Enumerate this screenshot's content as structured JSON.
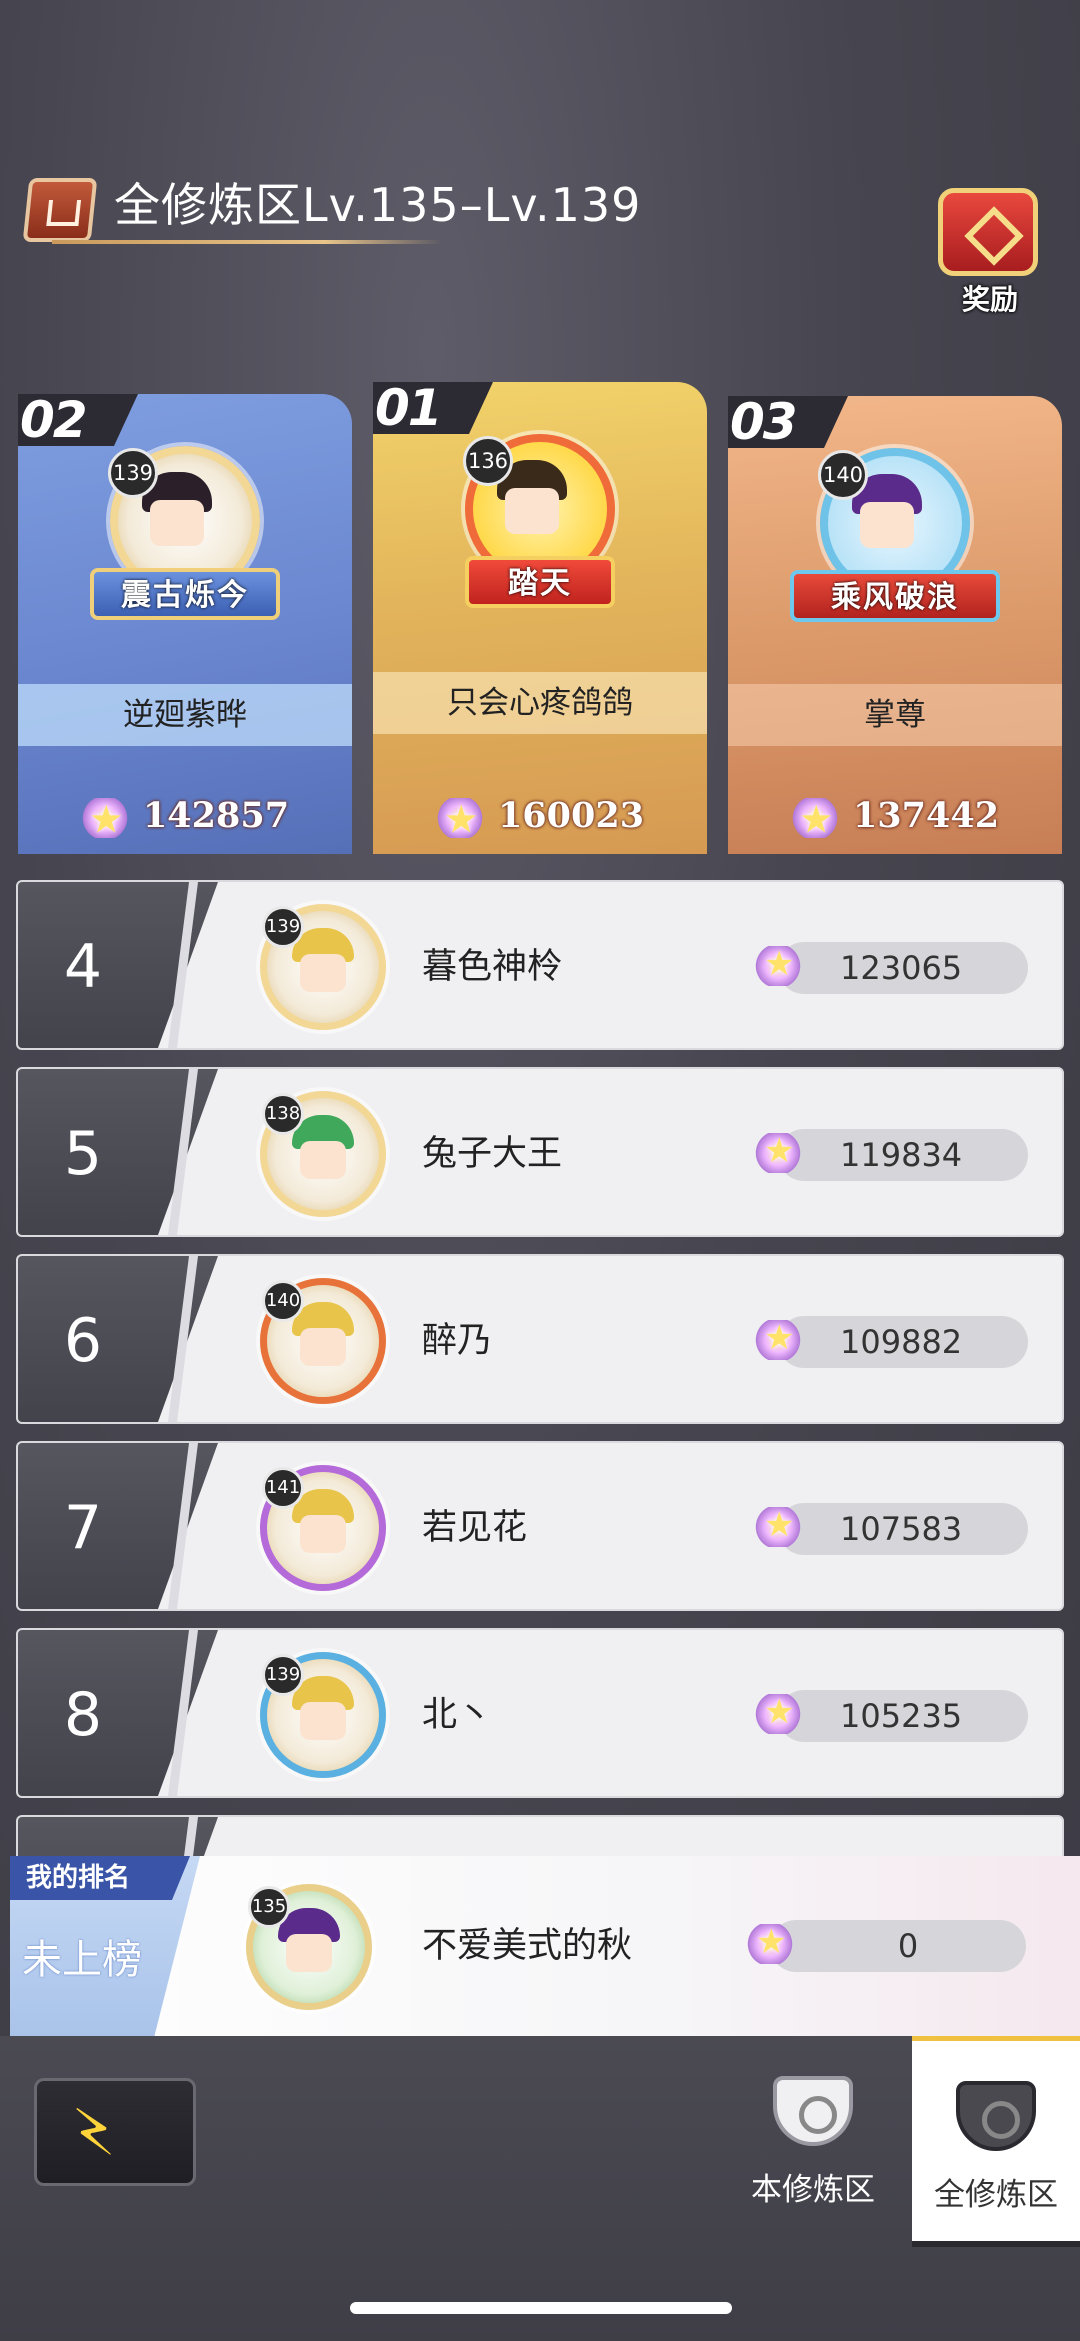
{
  "header": {
    "title": "全修炼区Lv.135–Lv.139",
    "icon": "region-icon"
  },
  "reward": {
    "label": "奖励",
    "icon": "treasure-chest-icon"
  },
  "podium": [
    {
      "slot": "first",
      "rank_label": "01",
      "level": "136",
      "title": "踏天",
      "name": "只会心疼鸽鸽",
      "score": "160023"
    },
    {
      "slot": "second",
      "rank_label": "02",
      "level": "139",
      "title": "震古烁今",
      "name": "逆廻紫晔",
      "score": "142857"
    },
    {
      "slot": "third",
      "rank_label": "03",
      "level": "140",
      "title": "乘风破浪",
      "name": "掌尊",
      "score": "137442"
    }
  ],
  "ranking": [
    {
      "rank": "4",
      "level": "139",
      "name": "暮色神柃",
      "score": "123065"
    },
    {
      "rank": "5",
      "level": "138",
      "name": "兔子大王",
      "score": "119834"
    },
    {
      "rank": "6",
      "level": "140",
      "name": "醉乃",
      "score": "109882"
    },
    {
      "rank": "7",
      "level": "141",
      "name": "若见花",
      "score": "107583"
    },
    {
      "rank": "8",
      "level": "139",
      "name": "北丶",
      "score": "105235"
    }
  ],
  "my_rank": {
    "tag": "我的排名",
    "status": "未上榜",
    "level": "135",
    "name": "不爱美式的秋",
    "score": "0"
  },
  "bottom_nav": {
    "back_icon": "lightning-back-icon",
    "tabs": [
      {
        "label": "本修炼区",
        "active": false
      },
      {
        "label": "全修炼区",
        "active": true
      }
    ]
  },
  "colors": {
    "background": "#47454f",
    "first_place": "#e2b45b",
    "second_place": "#6a86cf",
    "third_place": "#dc9a6a",
    "accent_gold": "#f0c040",
    "my_rank_tag": "#3a55a8"
  }
}
